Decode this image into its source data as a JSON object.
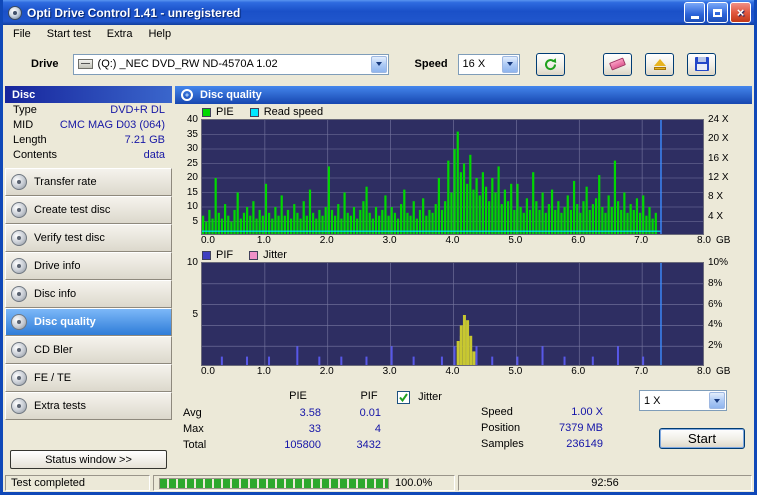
{
  "window": {
    "title": "Opti Drive Control 1.41 - unregistered"
  },
  "menu": {
    "items": [
      "File",
      "Start test",
      "Extra",
      "Help"
    ]
  },
  "toolbar": {
    "drive_label": "Drive",
    "drive_value": "(Q:) _NEC DVD_RW ND-4570A 1.02",
    "speed_label": "Speed",
    "speed_value": "16 X"
  },
  "sidebar": {
    "panel_title": "Disc",
    "info": [
      {
        "label": "Type",
        "value": "DVD+R DL"
      },
      {
        "label": "MID",
        "value": "CMC MAG D03 (064)"
      },
      {
        "label": "Length",
        "value": "7.21 GB"
      },
      {
        "label": "Contents",
        "value": "data"
      }
    ],
    "buttons": [
      {
        "label": "Transfer rate",
        "selected": false
      },
      {
        "label": "Create test disc",
        "selected": false
      },
      {
        "label": "Verify test disc",
        "selected": false
      },
      {
        "label": "Drive info",
        "selected": false
      },
      {
        "label": "Disc info",
        "selected": false
      },
      {
        "label": "Disc quality",
        "selected": true
      },
      {
        "label": "CD Bler",
        "selected": false
      },
      {
        "label": "FE / TE",
        "selected": false
      },
      {
        "label": "Extra tests",
        "selected": false
      }
    ],
    "status_window_label": "Status window >>"
  },
  "main": {
    "panel_title": "Disc quality"
  },
  "stats": {
    "col_headers": [
      "PIE",
      "PIF"
    ],
    "rows": [
      {
        "label": "Avg",
        "pie": "3.58",
        "pif": "0.01"
      },
      {
        "label": "Max",
        "pie": "33",
        "pif": "4"
      },
      {
        "label": "Total",
        "pie": "105800",
        "pif": "3432"
      }
    ],
    "jitter_label": "Jitter",
    "jitter_checked": true,
    "speed_label": "Speed",
    "speed_value": "1.00 X",
    "position_label": "Position",
    "position_value": "7379 MB",
    "samples_label": "Samples",
    "samples_value": "236149",
    "speed_select_value": "1 X",
    "start_label": "Start"
  },
  "statusbar": {
    "status_text": "Test completed",
    "progress_text": "100.0%",
    "time_text": "92:56"
  },
  "colors": {
    "chart_bg": "#2E2E62",
    "grid_line": "#8585AC",
    "pie_green": "#00D800",
    "read_speed_cyan": "#00E8FF",
    "pif_blue": "#5858E8",
    "jitter_bar_yellow": "#C8C830",
    "jitter_legend_pink": "#F090C8",
    "cursor_blue": "#3C8CFF",
    "value_navy": "#1414A8",
    "progress_green": "#2DA82D"
  },
  "chart_data": [
    {
      "type": "bar",
      "title": "PIE / Read speed",
      "series": [
        {
          "name": "PIE",
          "color": "#00D800"
        },
        {
          "name": "Read speed",
          "color": "#00E8FF"
        }
      ],
      "x_start": 0.0,
      "x_step": 0.05,
      "pie_values": [
        7,
        5,
        9,
        6,
        20,
        8,
        6,
        11,
        7,
        5,
        9,
        15,
        6,
        8,
        10,
        7,
        12,
        6,
        9,
        7,
        18,
        8,
        6,
        10,
        7,
        14,
        7,
        9,
        6,
        11,
        8,
        6,
        12,
        7,
        16,
        8,
        6,
        9,
        7,
        10,
        24,
        9,
        7,
        11,
        6,
        15,
        8,
        7,
        10,
        6,
        9,
        12,
        17,
        8,
        6,
        10,
        7,
        9,
        14,
        7,
        10,
        8,
        6,
        11,
        16,
        8,
        7,
        12,
        6,
        9,
        13,
        7,
        9,
        8,
        11,
        20,
        9,
        12,
        26,
        15,
        30,
        36,
        22,
        25,
        18,
        28,
        16,
        20,
        14,
        22,
        17,
        12,
        20,
        15,
        24,
        11,
        16,
        12,
        18,
        9,
        18,
        10,
        8,
        13,
        9,
        22,
        12,
        9,
        15,
        8,
        11,
        16,
        9,
        12,
        8,
        10,
        14,
        9,
        19,
        11,
        8,
        12,
        17,
        9,
        11,
        13,
        21,
        10,
        8,
        14,
        10,
        26,
        12,
        9,
        15,
        8,
        11,
        9,
        13,
        8,
        14,
        7,
        10,
        6,
        8
      ],
      "read_speed_x": 1.0,
      "cursor_x": 7.3,
      "xlim": [
        0,
        8
      ],
      "ylim_left": [
        0,
        40
      ],
      "ylim_right": [
        0,
        24
      ],
      "yticks_left": [
        5,
        10,
        15,
        20,
        25,
        30,
        35,
        40
      ],
      "yticks_right": [
        4,
        8,
        12,
        16,
        20,
        24
      ],
      "y_right_suffix": " X",
      "grid_y_step": 5,
      "xticks": [
        0,
        1,
        2,
        3,
        4,
        5,
        6,
        7,
        8
      ],
      "x_unit": "GB"
    },
    {
      "type": "bar",
      "title": "PIF / Jitter",
      "series": [
        {
          "name": "PIF",
          "color": "#4040C0"
        },
        {
          "name": "Jitter",
          "color": "#F090C8"
        }
      ],
      "pif_points": [
        [
          0.3,
          1
        ],
        [
          0.7,
          1
        ],
        [
          1.05,
          1
        ],
        [
          1.5,
          2
        ],
        [
          1.85,
          1
        ],
        [
          2.2,
          1
        ],
        [
          2.6,
          1
        ],
        [
          3.0,
          2
        ],
        [
          3.35,
          1
        ],
        [
          3.8,
          1
        ],
        [
          4.0,
          2
        ],
        [
          4.1,
          3
        ],
        [
          4.2,
          4
        ],
        [
          4.35,
          2
        ],
        [
          4.6,
          1
        ],
        [
          5.0,
          1
        ],
        [
          5.4,
          2
        ],
        [
          5.75,
          1
        ],
        [
          6.2,
          1
        ],
        [
          6.6,
          2
        ],
        [
          7.0,
          1
        ]
      ],
      "jitter_points": [
        [
          4.05,
          2.5
        ],
        [
          4.1,
          4
        ],
        [
          4.15,
          5
        ],
        [
          4.2,
          4.5
        ],
        [
          4.25,
          3
        ],
        [
          4.3,
          1.5
        ]
      ],
      "cursor_x": 7.3,
      "xlim": [
        0,
        8
      ],
      "ylim_left": [
        0,
        10
      ],
      "ylim_right_pct": [
        0,
        10
      ],
      "yticks_left": [
        5,
        10
      ],
      "yticks_right": [
        2,
        4,
        6,
        8,
        10
      ],
      "y_right_suffix": "%",
      "grid_y_step": 2,
      "xticks": [
        0,
        1,
        2,
        3,
        4,
        5,
        6,
        7,
        8
      ],
      "x_unit": "GB"
    }
  ]
}
